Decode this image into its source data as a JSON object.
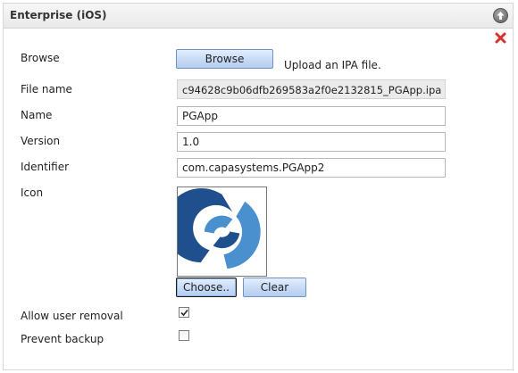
{
  "panel": {
    "title": "Enterprise (iOS)"
  },
  "icons": {
    "collapse": "arrow-up-circle-icon",
    "close": "red-x-icon",
    "app_logo": "capa-logo-icon",
    "check": "checkmark-icon"
  },
  "form": {
    "browse": {
      "label": "Browse",
      "button": "Browse",
      "hint": "Upload an IPA file."
    },
    "file_name": {
      "label": "File name",
      "value": "c94628c9b06dfb269583a2f0e2132815_PGApp.ipa"
    },
    "name": {
      "label": "Name",
      "value": "PGApp"
    },
    "version": {
      "label": "Version",
      "value": "1.0"
    },
    "identifier": {
      "label": "Identifier",
      "value": "com.capasystems.PGApp2"
    },
    "icon": {
      "label": "Icon",
      "choose_button": "Choose..",
      "clear_button": "Clear"
    },
    "allow_user_removal": {
      "label": "Allow user removal",
      "checked": true
    },
    "prevent_backup": {
      "label": "Prevent backup",
      "checked": false
    }
  },
  "colors": {
    "logo_dark": "#1f4f8c",
    "logo_light": "#4a90cf",
    "close_red": "#d9302b",
    "button_border": "#6f93c9"
  }
}
